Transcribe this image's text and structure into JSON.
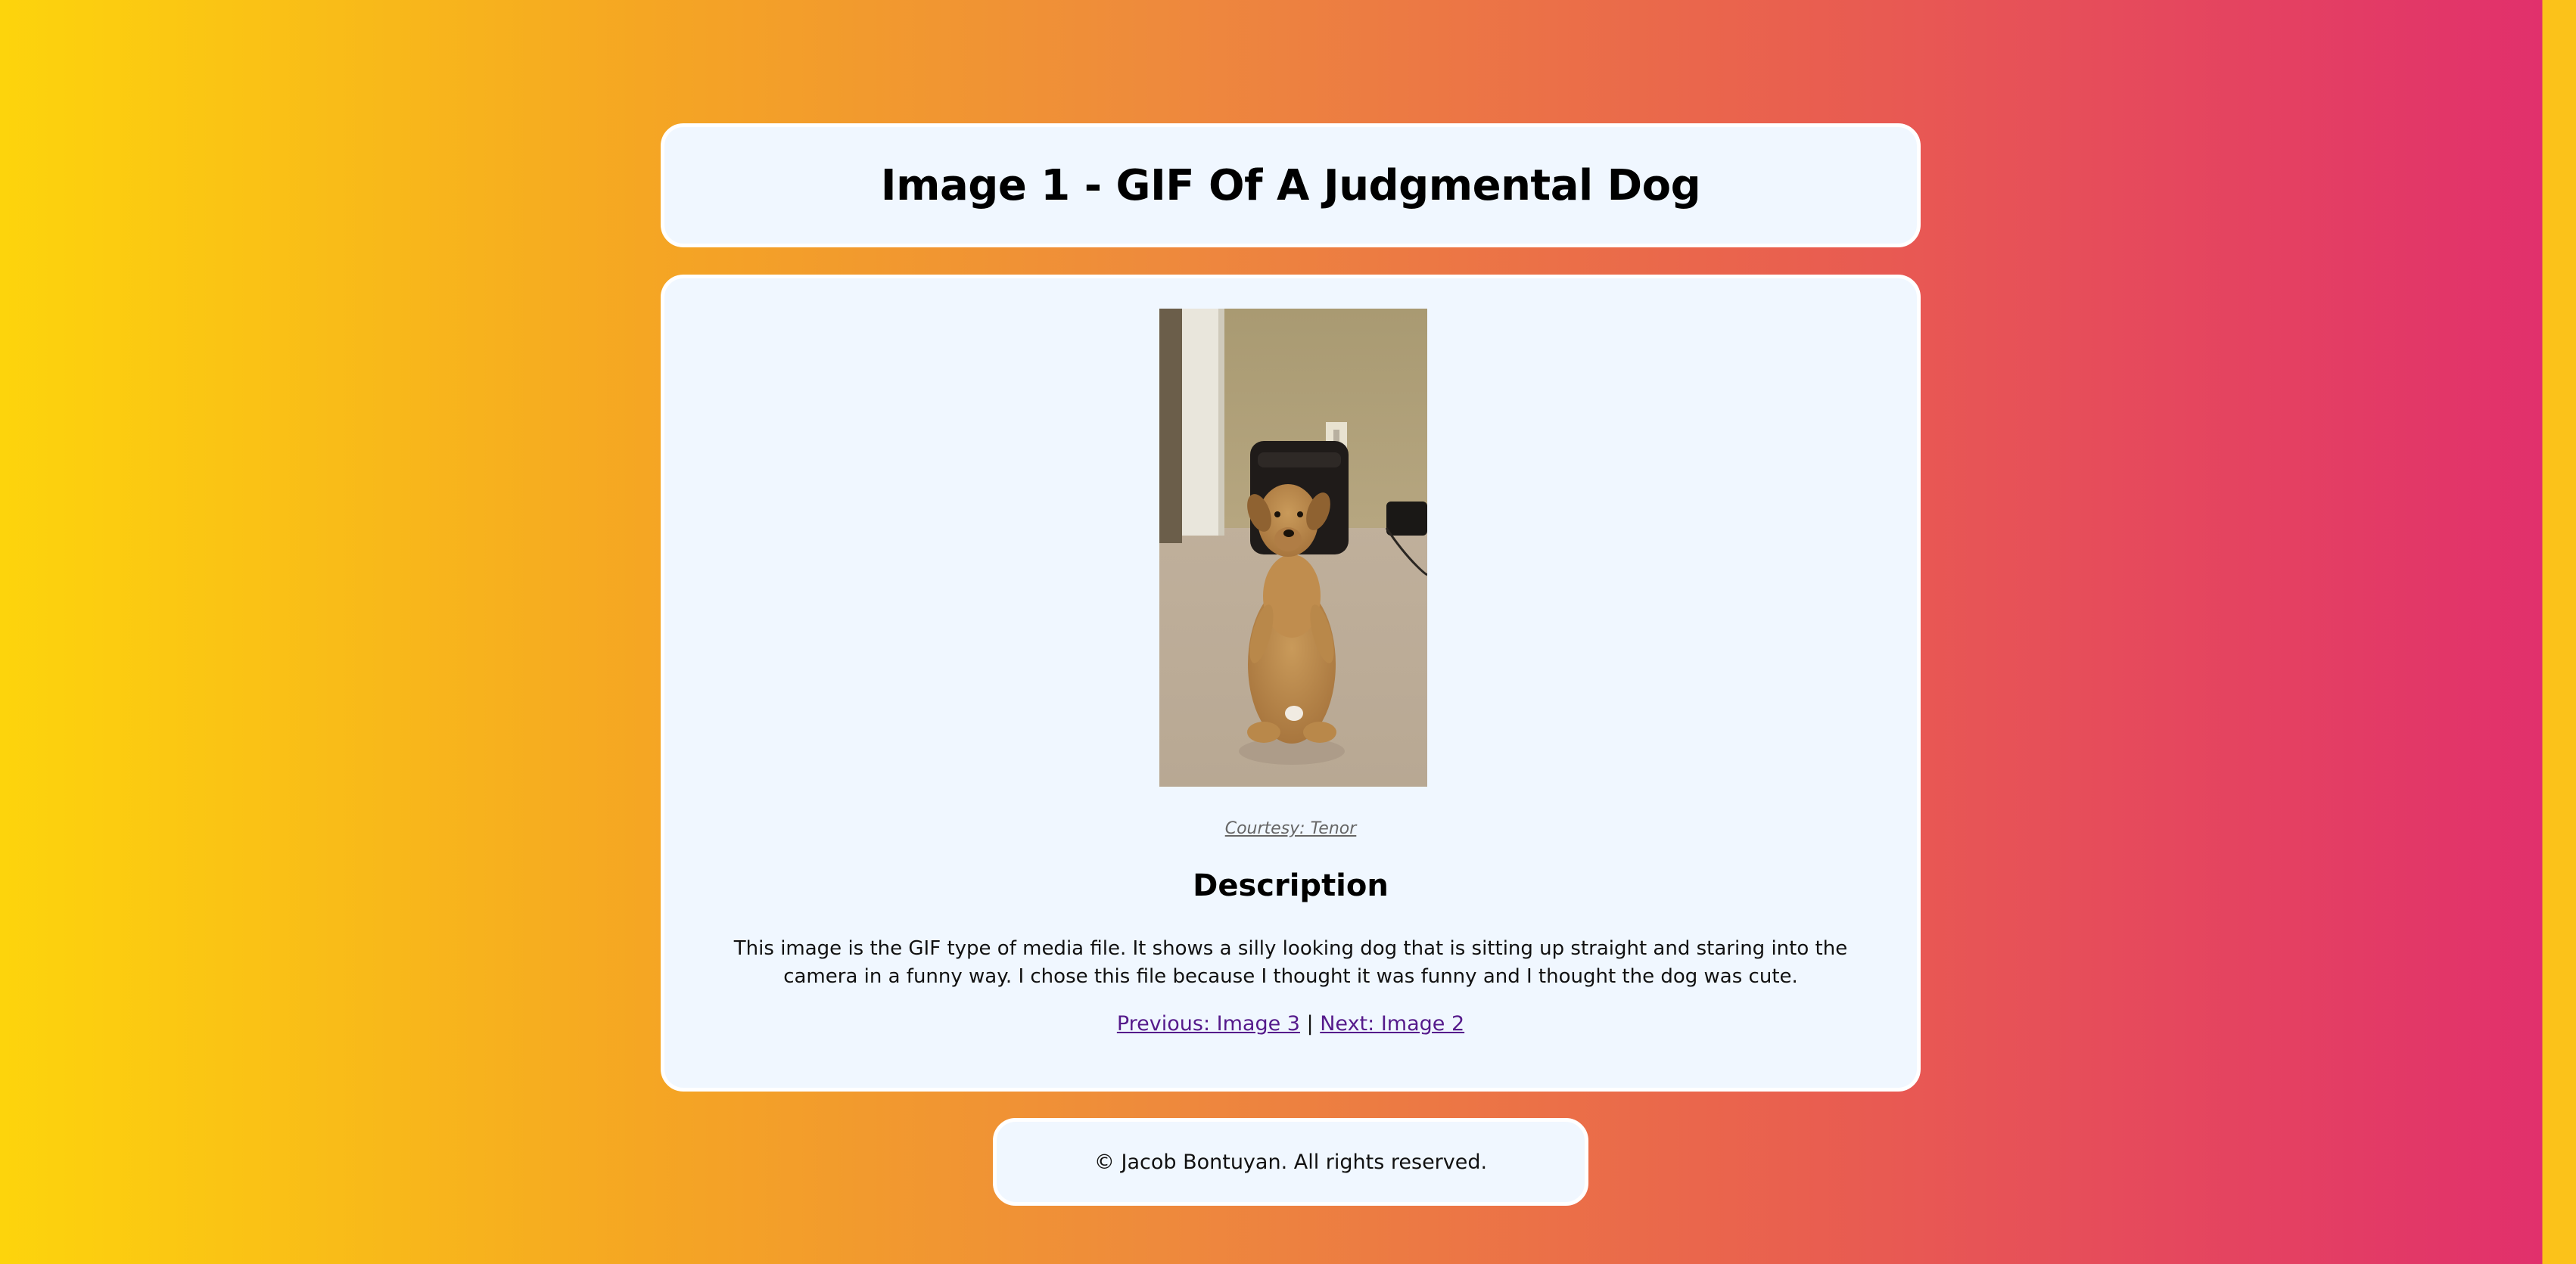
{
  "header": {
    "title": "Image 1 - GIF Of A Judgmental Dog"
  },
  "main": {
    "image_alt": "GIF of a judgmental dog",
    "credit": "Courtesy: Tenor",
    "description_heading": "Description",
    "description_text": "This image is the GIF type of media file. It shows a silly looking dog that is sitting up straight and staring into the camera in a funny way. I chose this file because I thought it was funny and I thought the dog was cute.",
    "nav": {
      "previous": "Previous: Image 3",
      "separator": " | ",
      "next": "Next: Image 2"
    }
  },
  "footer": {
    "text": "© Jacob Bontuyan. All rights reserved."
  },
  "colors": {
    "card_background": "#f0f7ff",
    "visited_link": "#551a8b",
    "gradient_start": "#fdd40c",
    "gradient_end": "#e1306c"
  }
}
